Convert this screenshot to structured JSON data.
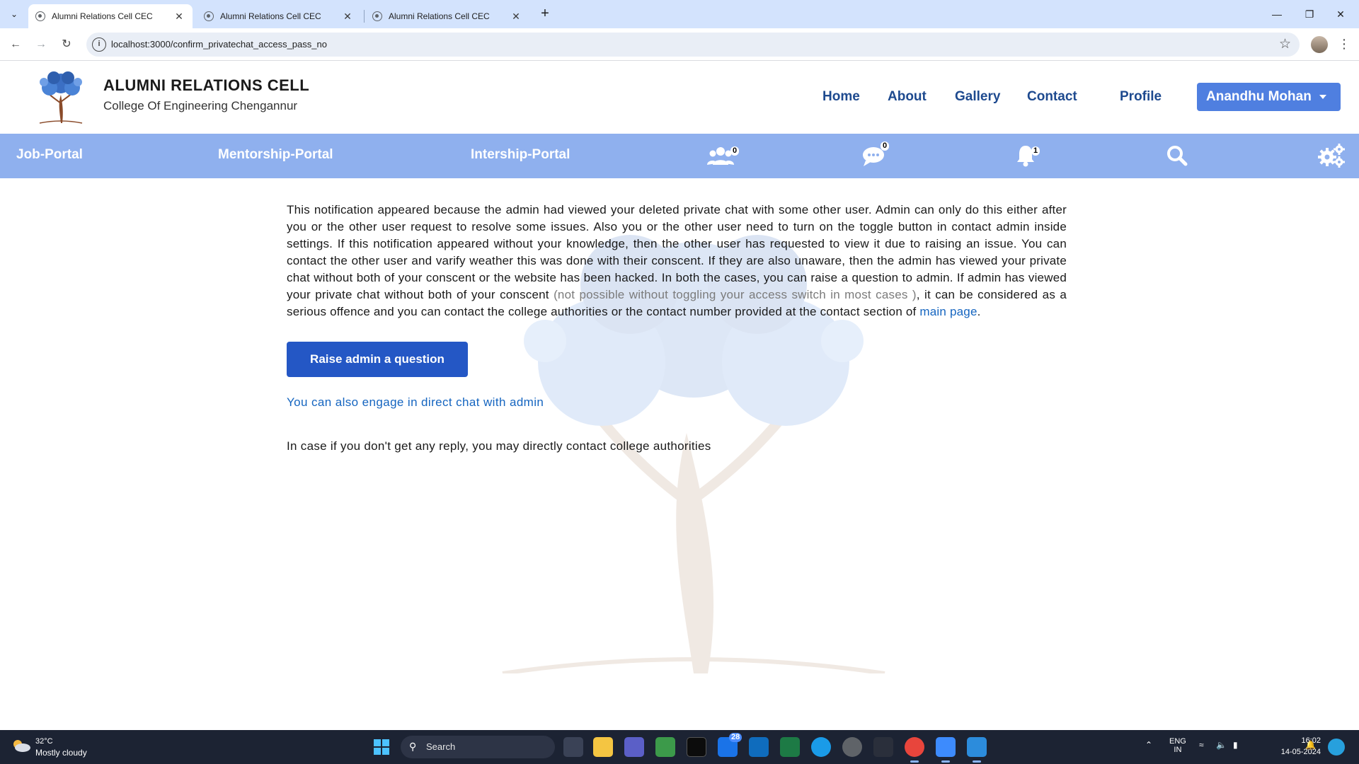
{
  "browser": {
    "tabs": [
      {
        "title": "Alumni Relations Cell CEC",
        "active": true
      },
      {
        "title": "Alumni Relations Cell CEC",
        "active": false
      },
      {
        "title": "Alumni Relations Cell CEC",
        "active": false
      }
    ],
    "url": "localhost:3000/confirm_privatechat_access_pass_no"
  },
  "header": {
    "title": "ALUMNI RELATIONS CELL",
    "subtitle": "College Of Engineering Chengannur",
    "nav": [
      "Home",
      "About",
      "Gallery",
      "Contact",
      "Profile"
    ],
    "user_name": "Anandhu Mohan"
  },
  "portal_bar": {
    "links": [
      "Job-Portal",
      "Mentorship-Portal",
      "Intership-Portal"
    ],
    "group_count": "0",
    "chat_count": "0",
    "notification_count": "1"
  },
  "main": {
    "paragraph_part1": "This notification appeared because the admin had viewed your deleted private chat with some other user. Admin can only do this either after you or the other user request to resolve some issues. Also you or the other user need to turn on the toggle button in contact admin inside settings. If this notification appeared without your knowledge, then the other user has requested to view it due to raising an issue. You can contact the other user and varify weather this was done with their conscent. If they are also unaware, then the admin has viewed your private chat without both of your conscent or the website has been hacked. In both the cases, you can raise a question to admin. If admin has viewed your private chat without both of your conscent ",
    "paragraph_muted": "(not possible without toggling your access switch in most cases )",
    "paragraph_part2": ", it can be considered as a serious offence and you can contact the college authorities or the contact number provided at the contact section of ",
    "paragraph_link": "main page",
    "paragraph_end": ".",
    "raise_button": "Raise admin a question",
    "direct_chat_link": "You can also engage in direct chat with admin",
    "fallback_text": "In case if you don't get any reply, you may directly contact college authorities"
  },
  "taskbar": {
    "temperature": "32°C",
    "weather": "Mostly cloudy",
    "search_label": "Search",
    "mail_badge": "28",
    "lang_line1": "ENG",
    "lang_line2": "IN",
    "time": "16:02",
    "date": "14-05-2024"
  }
}
